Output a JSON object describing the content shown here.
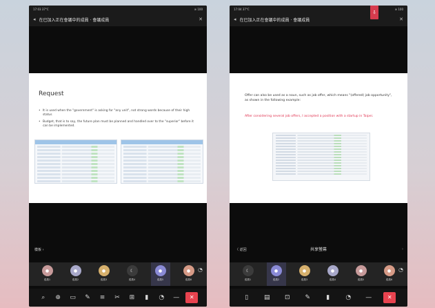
{
  "left": {
    "status": {
      "left": "17:03  37°C",
      "right": "≋ 100"
    },
    "title": "在已加入正在會議中的成員 · 會議成員",
    "slide": {
      "heading": "Request",
      "bullets": [
        "It is used when the \"government\" is asking for \"any unit\", not strong words because of their high status",
        "Budget, that is to say, the future plan must be planned and handled over to the \"superior\" before it can be implemented."
      ]
    },
    "bottom_label": "模板 ›",
    "participants": [
      {
        "name": "成員1",
        "color": "#c79a9a",
        "initial": "●"
      },
      {
        "name": "成員2",
        "color": "#a8a8c9",
        "initial": "●"
      },
      {
        "name": "成員3",
        "color": "#d6b06d",
        "initial": "●"
      },
      {
        "name": "成員4",
        "color": "#3b3b3b",
        "initial": "☾"
      },
      {
        "name": "成員5",
        "color": "#8a8ad6",
        "initial": "●",
        "active": true
      },
      {
        "name": "成員6",
        "color": "#d69a86",
        "initial": "●"
      }
    ],
    "toolbar": [
      "⌕",
      "⊕",
      "▭",
      "✎",
      "≡",
      "✂",
      "⊞",
      "▮",
      "◔",
      "—",
      "✕"
    ]
  },
  "right": {
    "status": {
      "left": "17:04  37°C",
      "right": "≋ 100"
    },
    "title": "在已加入正在會議中的成員 · 會議成員",
    "rec_badge": "⇩",
    "slide": {
      "para1": "Offer can also be used as a noun, such as job offer, which means \"(offered) job opportunity\", as shown in the following example:",
      "para2": "After considering several job offers, I accepted a position with a startup in Taipei."
    },
    "bottom_left": "〈 返回",
    "center_label": "共享螢幕",
    "participants": [
      {
        "name": "成員1",
        "color": "#3b3b3b",
        "initial": "☾"
      },
      {
        "name": "成員2",
        "color": "#8a8ad6",
        "initial": "●",
        "active": true
      },
      {
        "name": "成員3",
        "color": "#d6b06d",
        "initial": "●"
      },
      {
        "name": "成員4",
        "color": "#a8a8c9",
        "initial": "●"
      },
      {
        "name": "成員5",
        "color": "#c79a9a",
        "initial": "●"
      },
      {
        "name": "成員6",
        "color": "#d69a86",
        "initial": "●"
      }
    ],
    "toolbar": [
      "▯",
      "▤",
      "⊡",
      "✎",
      "▮",
      "◔",
      "—",
      "✕"
    ]
  }
}
